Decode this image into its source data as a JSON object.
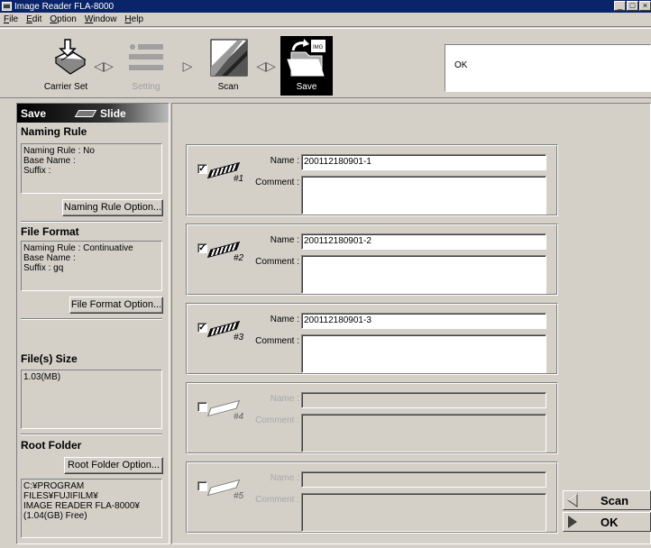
{
  "window": {
    "title": "Image Reader FLA-8000",
    "buttons": [
      "_",
      "□",
      "×"
    ]
  },
  "menu": [
    "File",
    "Edit",
    "Option",
    "Window",
    "Help"
  ],
  "toolbar": {
    "carrier_set": "Carrier Set",
    "setting": "Setting",
    "scan": "Scan",
    "save": "Save",
    "status": "OK"
  },
  "panel": {
    "header": "Save",
    "slide": "Slide",
    "naming_rule": {
      "title": "Naming Rule",
      "lines": [
        "Naming Rule : No",
        "Base Name :",
        "Suffix :"
      ],
      "button": "Naming Rule Option..."
    },
    "file_format": {
      "title": "File Format",
      "lines": [
        "Naming Rule : Continuative",
        "Base Name :",
        "Suffix : gq"
      ],
      "button": "File Format Option..."
    },
    "file_size": {
      "title": "File(s) Size",
      "value": "1.03(MB)"
    },
    "root_folder": {
      "title": "Root Folder",
      "button": "Root Folder Option...",
      "lines": [
        "C:¥PROGRAM FILES¥FUJIFILM¥",
        "IMAGE READER FLA-8000¥",
        "(1.04(GB) Free)"
      ]
    }
  },
  "entries": [
    {
      "num": "#1",
      "checked": true,
      "check_mark": "✓",
      "name_label": "Name :",
      "comment_label": "Comment :",
      "name": "200112180901-1"
    },
    {
      "num": "#2",
      "checked": true,
      "check_mark": "✓",
      "name_label": "Name :",
      "comment_label": "Comment :",
      "name": "200112180901-2"
    },
    {
      "num": "#3",
      "checked": true,
      "check_mark": "✓",
      "name_label": "Name :",
      "comment_label": "Comment :",
      "name": "200112180901-3"
    },
    {
      "num": "#4",
      "checked": false,
      "check_mark": "",
      "name_label": "Name :",
      "comment_label": "Comment :",
      "name": ""
    },
    {
      "num": "#5",
      "checked": false,
      "check_mark": "",
      "name_label": "Name :",
      "comment_label": "Comment :",
      "name": ""
    }
  ],
  "nav": {
    "back": "Scan",
    "next": "OK"
  }
}
